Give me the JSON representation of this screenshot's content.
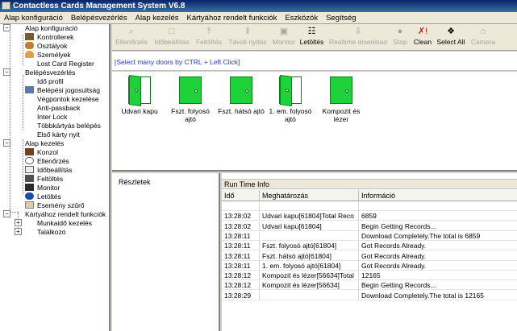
{
  "window": {
    "title": "Contactless Cards Management System  V6.8"
  },
  "menu": [
    "Alap konfiguráció",
    "Belépésvezérlés",
    "Alap kezelés",
    "Kártyához rendelt funkciók",
    "Eszközök",
    "Segítség"
  ],
  "tree": {
    "groups": [
      {
        "label": "Alap konfiguráció",
        "items": [
          "Kontrollerek",
          "Osztályok",
          "Személyek",
          "Lost Card Register"
        ]
      },
      {
        "label": "Belépésvezérlés",
        "items": [
          "Idő profil",
          "Belépési jogosultság",
          "Végpontok kezelése",
          "Anti-passback",
          "Inter Lock",
          "Többkártyás belépés",
          "Első kárty nyit"
        ]
      },
      {
        "label": "Alap kezelés",
        "items": [
          "Konzol",
          "Ellenőrzés",
          "Időbeállítás",
          "Feltöltés",
          "Monitor",
          "Letöltés",
          "Esemény szűrő"
        ]
      },
      {
        "label": "Kártyához rendelt funkciók",
        "items": [
          "Munkaidő kezelés",
          "Találkozó"
        ]
      }
    ]
  },
  "toolbar": {
    "buttons": [
      {
        "label": "Ellenőrzés",
        "icon": "search-icon",
        "enabled": false
      },
      {
        "label": "Időbeállítás",
        "icon": "clock-icon",
        "enabled": false
      },
      {
        "label": "Feltöltés",
        "icon": "upload-icon",
        "enabled": false
      },
      {
        "label": "Távoli nyitás",
        "icon": "remote-open-icon",
        "enabled": false
      },
      {
        "label": "Monitor",
        "icon": "monitor-icon",
        "enabled": false
      },
      {
        "label": "Letöltés",
        "icon": "download-icon",
        "enabled": true
      },
      {
        "label": "Realtime download",
        "icon": "realtime-download-icon",
        "enabled": false
      },
      {
        "label": "Stop",
        "icon": "stop-icon",
        "enabled": false
      },
      {
        "label": "Clean",
        "icon": "clean-icon",
        "enabled": true
      },
      {
        "label": "Select All",
        "icon": "select-all-icon",
        "enabled": true
      },
      {
        "label": "Camera",
        "icon": "camera-icon",
        "enabled": false
      }
    ]
  },
  "hint": "[Select many doors by CTRL + Left Click]",
  "doors": [
    {
      "name": "Udvari kapu",
      "state": "open"
    },
    {
      "name": "Fszt. folyosó ajtó",
      "state": "closed"
    },
    {
      "name": "Fszt. hátsó ajtó",
      "state": "closed"
    },
    {
      "name": "1. em. folyosó ajtó",
      "state": "open"
    },
    {
      "name": "Kompozit és lézer",
      "state": "closed"
    }
  ],
  "details": {
    "title": "Részletek"
  },
  "runtime": {
    "title": "Run Time Info",
    "columns": [
      "Idő",
      "Meghatározás",
      "Információ"
    ],
    "rows": [
      [
        "",
        "",
        ""
      ],
      [
        "13:28:02",
        "Udvari kapu[61804]Total Reco",
        "6859"
      ],
      [
        "13:28:02",
        "Udvari kapu[61804]",
        "Begin Getting Records..."
      ],
      [
        "13:28:11",
        "",
        "Download Completely.The total is  6859"
      ],
      [
        "13:28:11",
        "Fszt. folyosó ajtó[61804]",
        "Got Records Already."
      ],
      [
        "13:28:11",
        "Fszt. hátsó ajtó[61804]",
        "Got Records Already."
      ],
      [
        "13:28:11",
        "1. em. folyosó ajtó[61804]",
        "Got Records Already."
      ],
      [
        "13:28:12",
        "Kompozit és lézer[56634]Total",
        "12165"
      ],
      [
        "13:28:12",
        "Kompozit és lézer[56634]",
        "Begin Getting Records..."
      ],
      [
        "13:28:29",
        "",
        "Download Completely.The total is  12165"
      ]
    ]
  }
}
